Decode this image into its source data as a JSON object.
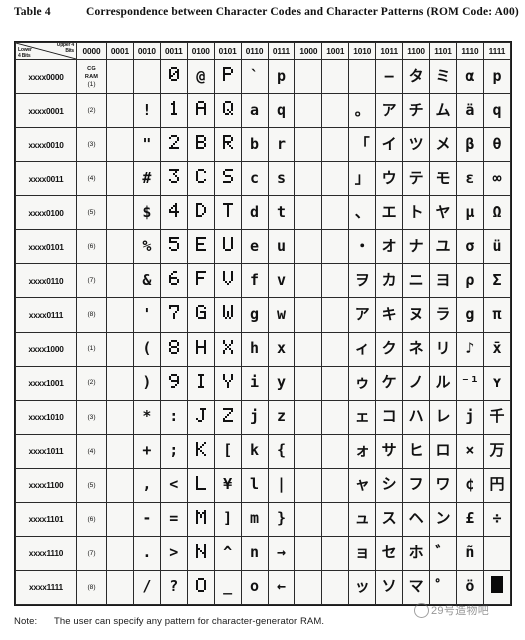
{
  "title": {
    "label": "Table 4",
    "text": "Correspondence between Character Codes and Character Patterns (ROM Code: A00)"
  },
  "note": {
    "label": "Note:",
    "text": "The user can specify any pattern for character-generator RAM."
  },
  "watermark": {
    "text": "29号造物吧"
  },
  "table": {
    "corner": {
      "upper": "Upper 4\nBits",
      "upper_line1": "Upper 4",
      "upper_line2": "Bits",
      "lower_line1": "Lower",
      "lower_line2": "4 Bits"
    },
    "column_headers": [
      "0000",
      "0001",
      "0010",
      "0011",
      "0100",
      "0101",
      "0110",
      "0111",
      "1000",
      "1001",
      "1010",
      "1011",
      "1100",
      "1101",
      "1110",
      "1111"
    ],
    "row_headers": [
      "xxxx0000",
      "xxxx0001",
      "xxxx0010",
      "xxxx0011",
      "xxxx0100",
      "xxxx0101",
      "xxxx0110",
      "xxxx0111",
      "xxxx1000",
      "xxxx1001",
      "xxxx1010",
      "xxxx1011",
      "xxxx1100",
      "xxxx1101",
      "xxxx1110",
      "xxxx1111"
    ],
    "cgram_column": {
      "header_top": "CG",
      "header_mid": "RAM",
      "labels": [
        "CG RAM (1)",
        "(2)",
        "(3)",
        "(4)",
        "(5)",
        "(6)",
        "(7)",
        "(8)",
        "(1)",
        "(2)",
        "(3)",
        "(4)",
        "(5)",
        "(6)",
        "(7)",
        "(8)"
      ]
    },
    "empty_columns": [
      "0001",
      "1000",
      "1001"
    ],
    "rows": [
      {
        "row_header": "xxxx0000",
        "cgram": "CG RAM (1)",
        "cells": [
          "",
          "",
          "",
          "0",
          "@",
          "P",
          "`",
          "p",
          "",
          "",
          "",
          "—",
          "タ",
          "ミ",
          "α",
          "p"
        ]
      },
      {
        "row_header": "xxxx0001",
        "cgram": "(2)",
        "cells": [
          "",
          "",
          "!",
          "1",
          "A",
          "Q",
          "a",
          "q",
          "",
          "",
          "。",
          "ア",
          "チ",
          "ム",
          "ä",
          "q"
        ]
      },
      {
        "row_header": "xxxx0010",
        "cgram": "(3)",
        "cells": [
          "",
          "",
          "\"",
          "2",
          "B",
          "R",
          "b",
          "r",
          "",
          "",
          "「",
          "イ",
          "ツ",
          "メ",
          "β",
          "θ"
        ]
      },
      {
        "row_header": "xxxx0011",
        "cgram": "(4)",
        "cells": [
          "",
          "",
          "#",
          "3",
          "C",
          "S",
          "c",
          "s",
          "",
          "",
          "」",
          "ウ",
          "テ",
          "モ",
          "ε",
          "∞"
        ]
      },
      {
        "row_header": "xxxx0100",
        "cgram": "(5)",
        "cells": [
          "",
          "",
          "$",
          "4",
          "D",
          "T",
          "d",
          "t",
          "",
          "",
          "、",
          "エ",
          "ト",
          "ヤ",
          "µ",
          "Ω"
        ]
      },
      {
        "row_header": "xxxx0101",
        "cgram": "(6)",
        "cells": [
          "",
          "",
          "%",
          "5",
          "E",
          "U",
          "e",
          "u",
          "",
          "",
          "・",
          "オ",
          "ナ",
          "ユ",
          "σ",
          "ü"
        ]
      },
      {
        "row_header": "xxxx0110",
        "cgram": "(7)",
        "cells": [
          "",
          "",
          "&",
          "6",
          "F",
          "V",
          "f",
          "v",
          "",
          "",
          "ヲ",
          "カ",
          "ニ",
          "ヨ",
          "ρ",
          "Σ"
        ]
      },
      {
        "row_header": "xxxx0111",
        "cgram": "(8)",
        "cells": [
          "",
          "",
          "'",
          "7",
          "G",
          "W",
          "g",
          "w",
          "",
          "",
          "ア",
          "キ",
          "ヌ",
          "ラ",
          "g",
          "π"
        ]
      },
      {
        "row_header": "xxxx1000",
        "cgram": "(1)",
        "cells": [
          "",
          "",
          "(",
          "8",
          "H",
          "X",
          "h",
          "x",
          "",
          "",
          "ィ",
          "ク",
          "ネ",
          "リ",
          "♪",
          "x̄"
        ]
      },
      {
        "row_header": "xxxx1001",
        "cgram": "(2)",
        "cells": [
          "",
          "",
          ")",
          "9",
          "I",
          "Y",
          "i",
          "y",
          "",
          "",
          "ゥ",
          "ケ",
          "ノ",
          "ル",
          "⁻¹",
          "ʏ"
        ]
      },
      {
        "row_header": "xxxx1010",
        "cgram": "(3)",
        "cells": [
          "",
          "",
          "*",
          ":",
          "J",
          "Z",
          "j",
          "z",
          "",
          "",
          "ェ",
          "コ",
          "ハ",
          "レ",
          "j",
          "千"
        ]
      },
      {
        "row_header": "xxxx1011",
        "cgram": "(4)",
        "cells": [
          "",
          "",
          "+",
          ";",
          "K",
          "[",
          "k",
          "{",
          "",
          "",
          "ォ",
          "サ",
          "ヒ",
          "ロ",
          "×",
          "万"
        ]
      },
      {
        "row_header": "xxxx1100",
        "cgram": "(5)",
        "cells": [
          "",
          "",
          ",",
          "<",
          "L",
          "¥",
          "l",
          "|",
          "",
          "",
          "ャ",
          "シ",
          "フ",
          "ワ",
          "¢",
          "円"
        ]
      },
      {
        "row_header": "xxxx1101",
        "cgram": "(6)",
        "cells": [
          "",
          "",
          "-",
          "=",
          "M",
          "]",
          "m",
          "}",
          "",
          "",
          "ュ",
          "ス",
          "ヘ",
          "ン",
          "£",
          "÷"
        ]
      },
      {
        "row_header": "xxxx1110",
        "cgram": "(7)",
        "cells": [
          "",
          "",
          ".",
          ">",
          "N",
          "^",
          "n",
          "→",
          "",
          "",
          "ョ",
          "セ",
          "ホ",
          "゛",
          "ñ",
          ""
        ]
      },
      {
        "row_header": "xxxx1111",
        "cgram": "(8)",
        "cells": [
          "",
          "",
          "/",
          "?",
          "O",
          "_",
          "o",
          "←",
          "",
          "",
          "ッ",
          "ソ",
          "マ",
          "゜",
          "ö",
          "█"
        ]
      }
    ]
  },
  "glyph_bitmaps": {
    "comment": "5x8 dot-matrix bitmaps, one string per row of 5 dots; 1 = lit pixel",
    "0": [
      "01110",
      "10001",
      "10011",
      "10101",
      "11001",
      "10001",
      "01110",
      "00000"
    ],
    "1": [
      "00100",
      "01100",
      "00100",
      "00100",
      "00100",
      "00100",
      "01110",
      "00000"
    ],
    "2": [
      "01110",
      "10001",
      "00001",
      "00010",
      "00100",
      "01000",
      "11111",
      "00000"
    ],
    "3": [
      "11111",
      "00010",
      "00100",
      "00010",
      "00001",
      "10001",
      "01110",
      "00000"
    ],
    "4": [
      "00010",
      "00110",
      "01010",
      "10010",
      "11111",
      "00010",
      "00010",
      "00000"
    ],
    "5": [
      "11111",
      "10000",
      "11110",
      "00001",
      "00001",
      "10001",
      "01110",
      "00000"
    ],
    "6": [
      "00110",
      "01000",
      "10000",
      "11110",
      "10001",
      "10001",
      "01110",
      "00000"
    ],
    "7": [
      "11111",
      "10001",
      "00001",
      "00010",
      "00100",
      "00100",
      "00100",
      "00000"
    ],
    "8": [
      "01110",
      "10001",
      "10001",
      "01110",
      "10001",
      "10001",
      "01110",
      "00000"
    ],
    "9": [
      "01110",
      "10001",
      "10001",
      "01111",
      "00001",
      "00010",
      "01100",
      "00000"
    ],
    "A": [
      "01110",
      "10001",
      "10001",
      "11111",
      "10001",
      "10001",
      "10001",
      "00000"
    ],
    "B": [
      "11110",
      "10001",
      "10001",
      "11110",
      "10001",
      "10001",
      "11110",
      "00000"
    ],
    "C": [
      "01110",
      "10001",
      "10000",
      "10000",
      "10000",
      "10001",
      "01110",
      "00000"
    ],
    "D": [
      "11100",
      "10010",
      "10001",
      "10001",
      "10001",
      "10010",
      "11100",
      "00000"
    ],
    "E": [
      "11111",
      "10000",
      "10000",
      "11110",
      "10000",
      "10000",
      "11111",
      "00000"
    ],
    "F": [
      "11111",
      "10000",
      "10000",
      "11110",
      "10000",
      "10000",
      "10000",
      "00000"
    ],
    "G": [
      "01110",
      "10001",
      "10000",
      "10111",
      "10001",
      "10001",
      "01111",
      "00000"
    ],
    "H": [
      "10001",
      "10001",
      "10001",
      "11111",
      "10001",
      "10001",
      "10001",
      "00000"
    ],
    "I": [
      "01110",
      "00100",
      "00100",
      "00100",
      "00100",
      "00100",
      "01110",
      "00000"
    ],
    "J": [
      "00111",
      "00010",
      "00010",
      "00010",
      "00010",
      "10010",
      "01100",
      "00000"
    ],
    "K": [
      "10001",
      "10010",
      "10100",
      "11000",
      "10100",
      "10010",
      "10001",
      "00000"
    ],
    "L": [
      "10000",
      "10000",
      "10000",
      "10000",
      "10000",
      "10000",
      "11111",
      "00000"
    ],
    "M": [
      "10001",
      "11011",
      "10101",
      "10101",
      "10001",
      "10001",
      "10001",
      "00000"
    ],
    "N": [
      "10001",
      "10001",
      "11001",
      "10101",
      "10011",
      "10001",
      "10001",
      "00000"
    ],
    "O": [
      "01110",
      "10001",
      "10001",
      "10001",
      "10001",
      "10001",
      "01110",
      "00000"
    ],
    "P": [
      "11110",
      "10001",
      "10001",
      "11110",
      "10000",
      "10000",
      "10000",
      "00000"
    ],
    "Q": [
      "01110",
      "10001",
      "10001",
      "10001",
      "10101",
      "10010",
      "01101",
      "00000"
    ],
    "R": [
      "11110",
      "10001",
      "10001",
      "11110",
      "10100",
      "10010",
      "10001",
      "00000"
    ],
    "S": [
      "01111",
      "10000",
      "10000",
      "01110",
      "00001",
      "00001",
      "11110",
      "00000"
    ],
    "T": [
      "11111",
      "00100",
      "00100",
      "00100",
      "00100",
      "00100",
      "00100",
      "00000"
    ],
    "U": [
      "10001",
      "10001",
      "10001",
      "10001",
      "10001",
      "10001",
      "01110",
      "00000"
    ],
    "V": [
      "10001",
      "10001",
      "10001",
      "10001",
      "10001",
      "01010",
      "00100",
      "00000"
    ],
    "W": [
      "10001",
      "10001",
      "10001",
      "10101",
      "10101",
      "10101",
      "01010",
      "00000"
    ],
    "X": [
      "10001",
      "10001",
      "01010",
      "00100",
      "01010",
      "10001",
      "10001",
      "00000"
    ],
    "Y": [
      "10001",
      "10001",
      "10001",
      "01010",
      "00100",
      "00100",
      "00100",
      "00000"
    ],
    "Z": [
      "11111",
      "00001",
      "00010",
      "00100",
      "01000",
      "10000",
      "11111",
      "00000"
    ]
  }
}
